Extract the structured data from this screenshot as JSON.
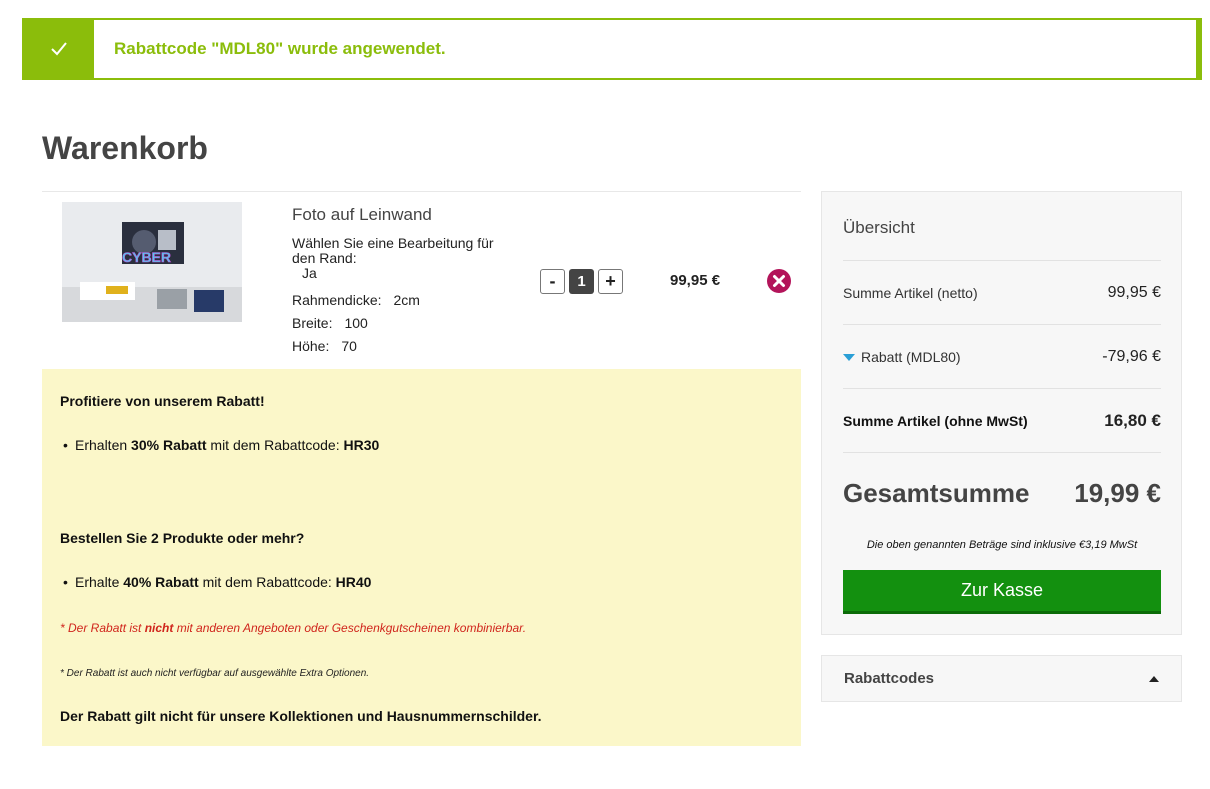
{
  "notice": {
    "message": "Rabattcode \"MDL80\" wurde angewendet.",
    "accent": "#8bbd0b"
  },
  "page_title": "Warenkorb",
  "cart_item": {
    "name": "Foto auf Leinwand",
    "image_text": "CYBER",
    "options": [
      {
        "label": "Wählen Sie eine Bearbeitung für den Rand:",
        "value": "Ja"
      },
      {
        "label": "Rahmendicke:",
        "value": "2cm"
      },
      {
        "label": "Breite:",
        "value": "100"
      },
      {
        "label": "Höhe:",
        "value": "70"
      }
    ],
    "qty_minus": "-",
    "quantity": "1",
    "qty_plus": "+",
    "price": "99,95 €"
  },
  "promo": {
    "heading1": "Profitiere von unserem Rabatt!",
    "offer1": {
      "pre": "Erhalten ",
      "bold": "30% Rabatt",
      "mid": " mit dem Rabattcode: ",
      "code": "HR30"
    },
    "heading2": "Bestellen Sie 2 Produkte oder mehr?",
    "offer2": {
      "pre": "Erhalte ",
      "bold": "40% Rabatt",
      "mid": " mit dem Rabattcode: ",
      "code": "HR40"
    },
    "note_red": {
      "pre": "* Der Rabatt ist ",
      "bold": "nicht",
      "post": " mit anderen Angeboten oder Geschenkgutscheinen kombinierbar."
    },
    "note_small": "* Der Rabatt ist auch nicht verfügbar auf ausgewählte Extra Optionen.",
    "footer": "Der Rabatt gilt nicht für unsere Kollektionen und Hausnummernschilder."
  },
  "summary": {
    "title": "Übersicht",
    "subtotal_label": "Summe Artikel (netto)",
    "subtotal_value": "99,95 €",
    "discount_label": "Rabatt (MDL80)",
    "discount_value": "-79,96 €",
    "net_label": "Summe Artikel (ohne MwSt)",
    "net_value": "16,80 €",
    "total_label": "Gesamtsumme",
    "total_value": "19,99 €",
    "tax_note": "Die oben genannten Beträge sind inklusive €3,19 MwSt",
    "checkout_label": "Zur Kasse",
    "checkout_color": "#13900f"
  },
  "codes": {
    "label": "Rabattcodes"
  }
}
